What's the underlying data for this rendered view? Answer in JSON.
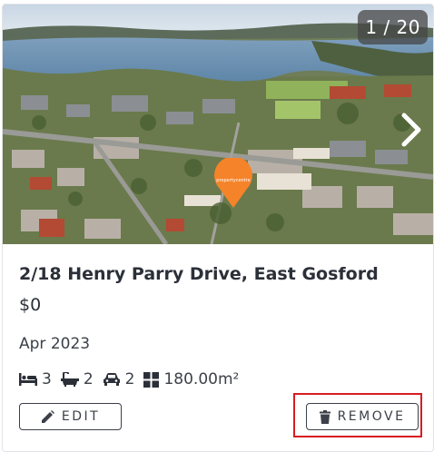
{
  "photo": {
    "counter": "1 / 20",
    "marker_text": "propertycentre",
    "next_icon": "chevron-right-icon"
  },
  "listing": {
    "address": "2/18 Henry Parry Drive, East Gosford",
    "price": "$0",
    "date": "Apr 2023",
    "bedrooms": "3",
    "bathrooms": "2",
    "parking": "2",
    "area": "180.00m²"
  },
  "actions": {
    "edit_label": "EDIT",
    "remove_label": "REMOVE"
  },
  "colors": {
    "marker": "#f5832a",
    "highlight": "#d81b22",
    "text": "#2b2f38"
  }
}
